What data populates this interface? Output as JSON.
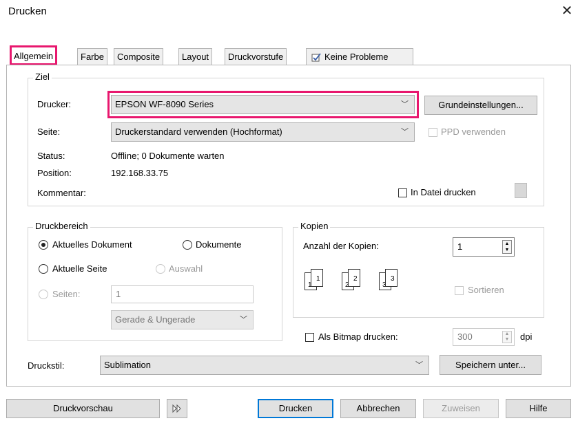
{
  "window": {
    "title": "Drucken",
    "close_glyph": "✕"
  },
  "tabs": [
    {
      "label": "Allgemein",
      "active": true
    },
    {
      "label": "Farbe"
    },
    {
      "label": "Composite"
    },
    {
      "label": "Layout"
    },
    {
      "label": "Druckvorstufe"
    },
    {
      "label": "Keine Probleme",
      "icon": "check-document-icon"
    }
  ],
  "ziel": {
    "legend": "Ziel",
    "drucker_label": "Drucker:",
    "drucker_value": "EPSON WF-8090 Series",
    "grundeinstellungen_label": "Grundeinstellungen...",
    "seite_label": "Seite:",
    "seite_value": "Druckerstandard verwenden (Hochformat)",
    "ppd_label": "PPD verwenden",
    "status_label": "Status:",
    "status_value": "Offline; 0 Dokumente warten",
    "position_label": "Position:",
    "position_value": "192.168.33.75",
    "kommentar_label": "Kommentar:",
    "in_datei_label": "In Datei drucken"
  },
  "druckbereich": {
    "legend": "Druckbereich",
    "aktuelles_dokument": "Aktuelles Dokument",
    "dokumente": "Dokumente",
    "aktuelle_seite": "Aktuelle Seite",
    "auswahl": "Auswahl",
    "seiten": "Seiten:",
    "seiten_value": "1",
    "gerade_ungerade": "Gerade & Ungerade"
  },
  "kopien": {
    "legend": "Kopien",
    "anzahl_label": "Anzahl der Kopien:",
    "anzahl_value": "1",
    "sortieren_label": "Sortieren",
    "pages": [
      "1",
      "1",
      "2",
      "2",
      "3",
      "3"
    ]
  },
  "bitmap": {
    "label": "Als Bitmap drucken:",
    "dpi_value": "300",
    "dpi_unit": "dpi"
  },
  "druckstil": {
    "label": "Druckstil:",
    "value": "Sublimation",
    "speichern_label": "Speichern unter..."
  },
  "footer": {
    "druckvorschau": "Druckvorschau",
    "drucken": "Drucken",
    "abbrechen": "Abbrechen",
    "zuweisen": "Zuweisen",
    "hilfe": "Hilfe"
  },
  "colors": {
    "highlight": "#e8176e",
    "accent_border": "#0078d7"
  }
}
